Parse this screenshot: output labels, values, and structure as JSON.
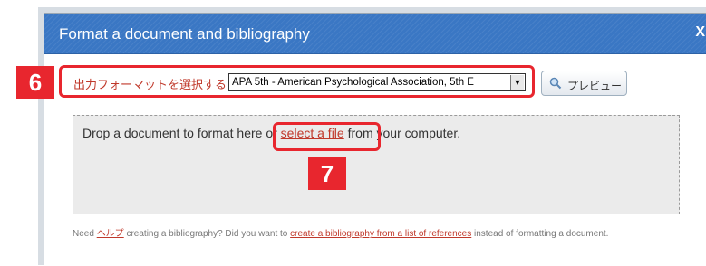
{
  "dialog": {
    "title": "Format a document and bibliography",
    "close_label": "X"
  },
  "format_select": {
    "label": "出力フォーマットを選択する",
    "selected": "APA 5th - American Psychological Association, 5th E"
  },
  "preview_button": {
    "label": "プレビュー"
  },
  "badges": {
    "step6": "6",
    "step7": "7"
  },
  "drop_zone": {
    "text_before": "Drop a document to format here or ",
    "link": "select a file",
    "text_after": " from your computer."
  },
  "footer": {
    "need": "Need ",
    "help_link": "ヘルプ",
    "middle": " creating a bibliography? Did you want to ",
    "list_link": "create a bibliography from a list of references",
    "end": " instead of formatting a document."
  },
  "colors": {
    "titlebar": "#3a77c4",
    "highlight": "#e8262e",
    "link": "#c0392b",
    "drop_zone_bg": "#ebebeb"
  }
}
